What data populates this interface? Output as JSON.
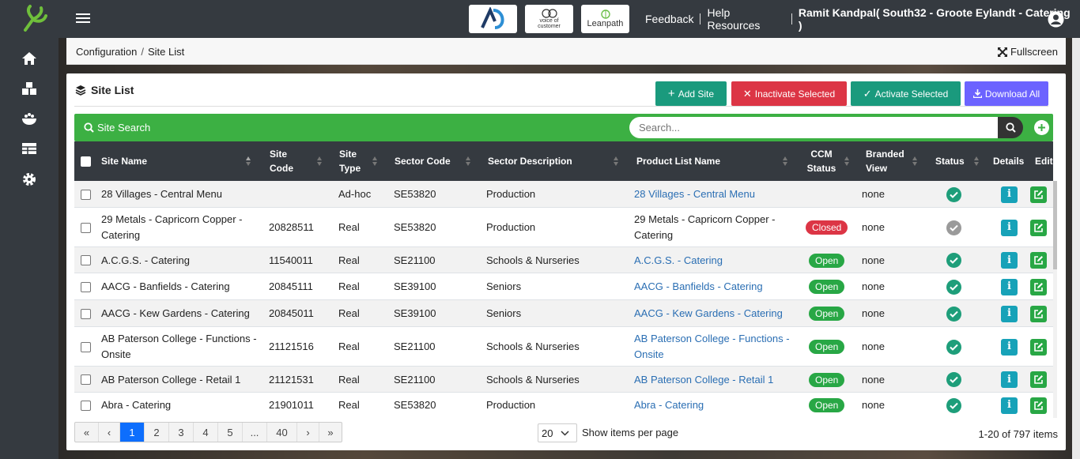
{
  "header": {
    "brands": [
      "AD",
      "voice of customer",
      "Leanpath"
    ],
    "links": [
      "Feedback",
      "Help Resources"
    ],
    "user": "Ramit Kandpal( South32 - Groote Eylandt - Catering )"
  },
  "sidebar": {
    "icons": [
      "home-icon",
      "boxes-icon",
      "food-bowl-icon",
      "table-icon",
      "gear-icon"
    ]
  },
  "breadcrumb": {
    "section": "Configuration",
    "page": "Site List"
  },
  "fullscreen_label": "Fullscreen",
  "card": {
    "title": "Site List",
    "buttons": {
      "add": "Add Site",
      "inactivate": "Inactivate Selected",
      "activate": "Activate Selected",
      "download": "Download All"
    },
    "colors": {
      "add": "#1a9a7d",
      "inactivate": "#dc3545",
      "activate": "#1a9a7d",
      "download": "#6c63ff"
    }
  },
  "search": {
    "label": "Site Search",
    "placeholder": "Search..."
  },
  "table": {
    "columns": [
      "Site Name",
      "Site Code",
      "Site Type",
      "Sector Code",
      "Sector Description",
      "Product List Name",
      "CCM Status",
      "Branded View",
      "Status",
      "Details",
      "Edit"
    ],
    "rows": [
      {
        "name": "28 Villages - Central Menu",
        "code": "",
        "type": "Ad-hoc",
        "sector_code": "SE53820",
        "sector_desc": "Production",
        "product_list": "28 Villages - Central Menu",
        "product_link": true,
        "ccm": "",
        "branded": "none",
        "status": "active"
      },
      {
        "name": "29 Metals - Capricorn Copper - Catering",
        "code": "20828511",
        "type": "Real",
        "sector_code": "SE53820",
        "sector_desc": "Production",
        "product_list": "29 Metals - Capricorn Copper - Catering",
        "product_link": false,
        "ccm": "Closed",
        "branded": "none",
        "status": "inactive"
      },
      {
        "name": "A.C.G.S. - Catering",
        "code": "11540011",
        "type": "Real",
        "sector_code": "SE21100",
        "sector_desc": "Schools & Nurseries",
        "product_list": "A.C.G.S. - Catering",
        "product_link": true,
        "ccm": "Open",
        "branded": "none",
        "status": "active"
      },
      {
        "name": "AACG - Banfields - Catering",
        "code": "20845111",
        "type": "Real",
        "sector_code": "SE39100",
        "sector_desc": "Seniors",
        "product_list": "AACG - Banfields - Catering",
        "product_link": true,
        "ccm": "Open",
        "branded": "none",
        "status": "active"
      },
      {
        "name": "AACG - Kew Gardens - Catering",
        "code": "20845011",
        "type": "Real",
        "sector_code": "SE39100",
        "sector_desc": "Seniors",
        "product_list": "AACG - Kew Gardens - Catering",
        "product_link": true,
        "ccm": "Open",
        "branded": "none",
        "status": "active"
      },
      {
        "name": "AB Paterson College - Functions - Onsite",
        "code": "21121516",
        "type": "Real",
        "sector_code": "SE21100",
        "sector_desc": "Schools & Nurseries",
        "product_list": "AB Paterson College - Functions - Onsite",
        "product_link": true,
        "ccm": "Open",
        "branded": "none",
        "status": "active"
      },
      {
        "name": "AB Paterson College - Retail 1",
        "code": "21121531",
        "type": "Real",
        "sector_code": "SE21100",
        "sector_desc": "Schools & Nurseries",
        "product_list": "AB Paterson College - Retail 1",
        "product_link": true,
        "ccm": "Open",
        "branded": "none",
        "status": "active"
      },
      {
        "name": "Abra - Catering",
        "code": "21901011",
        "type": "Real",
        "sector_code": "SE53820",
        "sector_desc": "Production",
        "product_list": "Abra - Catering",
        "product_link": true,
        "ccm": "Open",
        "branded": "none",
        "status": "active"
      }
    ]
  },
  "pagination": {
    "pages": [
      "«",
      "‹",
      "1",
      "2",
      "3",
      "4",
      "5",
      "...",
      "40",
      "›",
      "»"
    ],
    "active": "1",
    "per_page": "20",
    "per_page_label": "Show items per page",
    "summary": "1-20 of 797 items"
  }
}
